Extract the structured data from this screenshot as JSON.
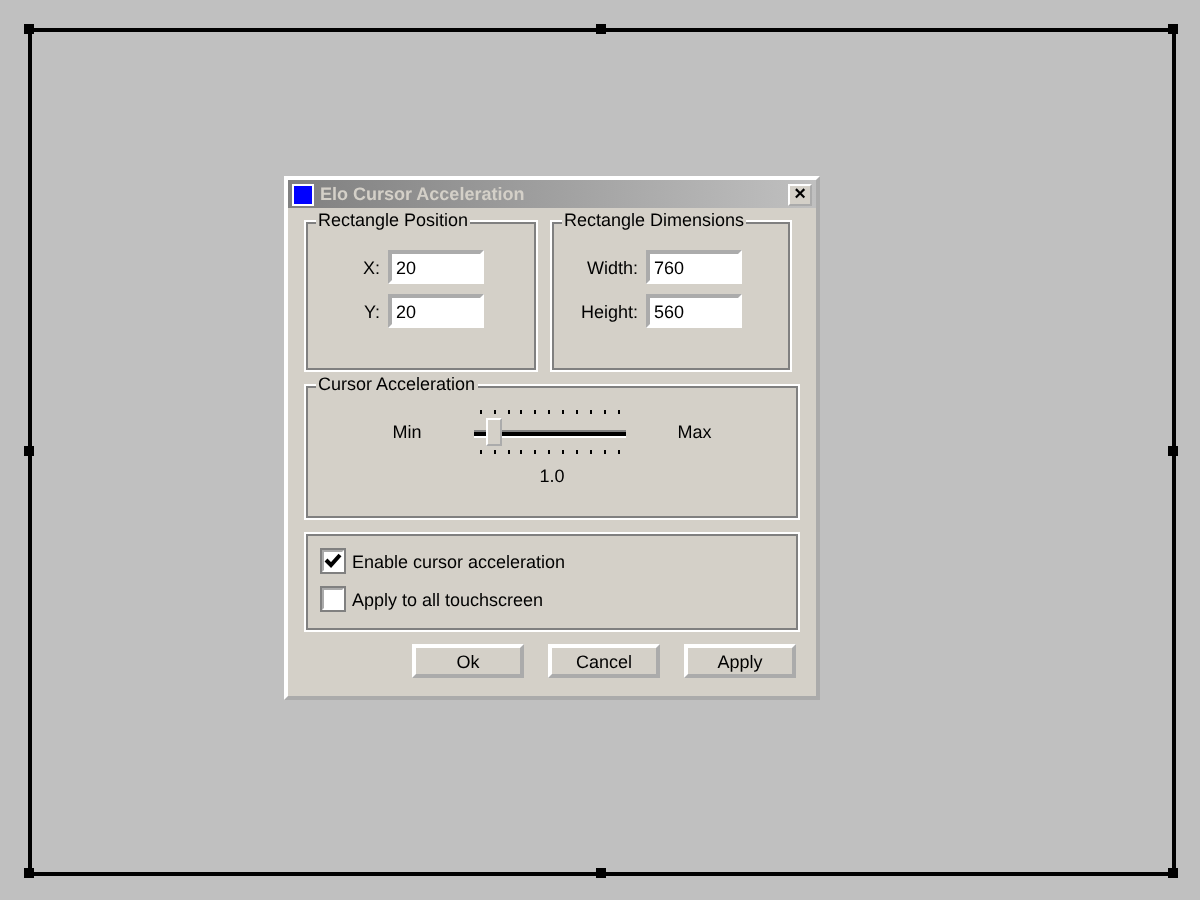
{
  "window": {
    "title": "Elo Cursor Acceleration",
    "close": "×"
  },
  "rectangle_position": {
    "title": "Rectangle Position",
    "fields": [
      {
        "label": "X:",
        "value": "20"
      },
      {
        "label": "Y:",
        "value": "20"
      }
    ]
  },
  "rectangle_dimensions": {
    "title": "Rectangle Dimensions",
    "fields": [
      {
        "label": "Width:",
        "value": "760"
      },
      {
        "label": "Height:",
        "value": "560"
      }
    ]
  },
  "cursor_acceleration": {
    "title": "Cursor Acceleration",
    "min_label": "Min",
    "max_label": "Max",
    "level": 0.1,
    "reading": "1.0"
  },
  "options": [
    {
      "label": "Enable cursor acceleration",
      "checked": true
    },
    {
      "label": "Apply to all touchscreen",
      "checked": false
    }
  ],
  "buttons": [
    "Ok",
    "Cancel",
    "Apply"
  ]
}
